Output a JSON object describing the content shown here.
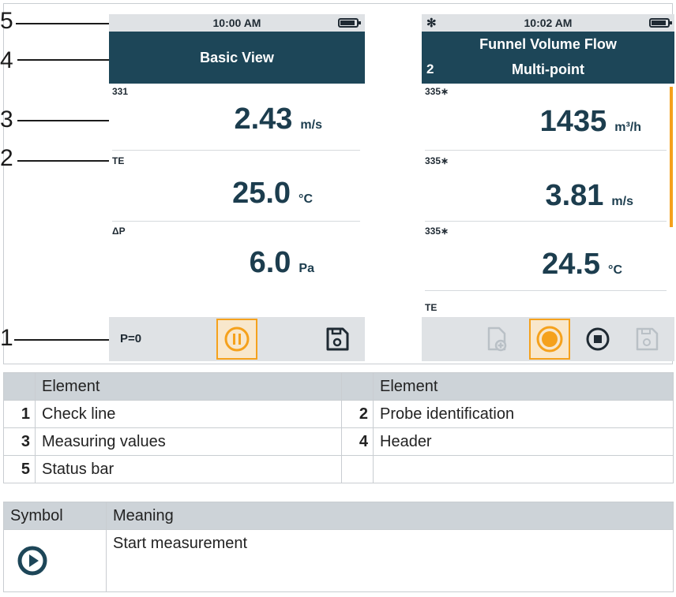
{
  "callouts": [
    "5",
    "4",
    "3",
    "2",
    "1"
  ],
  "left_screen": {
    "time": "10:00 AM",
    "header_title": "Basic View",
    "rows": [
      {
        "probe": "331",
        "value": "2.43",
        "unit": "m/s"
      },
      {
        "probe": "TE",
        "value": "25.0",
        "unit": "°C"
      },
      {
        "probe": "ΔP",
        "value": "6.0",
        "unit": "Pa"
      }
    ],
    "check_label": "P=0"
  },
  "right_screen": {
    "time": "10:02 AM",
    "header_title": "Funnel Volume Flow",
    "header_index": "2",
    "header_subtitle": "Multi-point",
    "rows": [
      {
        "probe": "335∗",
        "value": "1435",
        "unit": "m³/h"
      },
      {
        "probe": "335∗",
        "value": "3.81",
        "unit": "m/s"
      },
      {
        "probe": "335∗",
        "value": "24.5",
        "unit": "°C"
      }
    ],
    "extra_probe": "TE"
  },
  "elements_table": {
    "header": [
      "Element",
      "Element"
    ],
    "rows": [
      [
        {
          "num": "1",
          "label": "Check line"
        },
        {
          "num": "2",
          "label": "Probe identification"
        }
      ],
      [
        {
          "num": "3",
          "label": "Measuring values"
        },
        {
          "num": "4",
          "label": "Header"
        }
      ],
      [
        {
          "num": "5",
          "label": "Status bar"
        },
        {
          "num": "",
          "label": ""
        }
      ]
    ]
  },
  "symbols_table": {
    "header": [
      "Symbol",
      "Meaning"
    ],
    "rows": [
      {
        "icon": "play-circle-icon",
        "meaning": "Start measurement"
      }
    ]
  },
  "colors": {
    "header": "#1d4658",
    "accent": "#f5a11c",
    "bar": "#dfe2e5"
  }
}
